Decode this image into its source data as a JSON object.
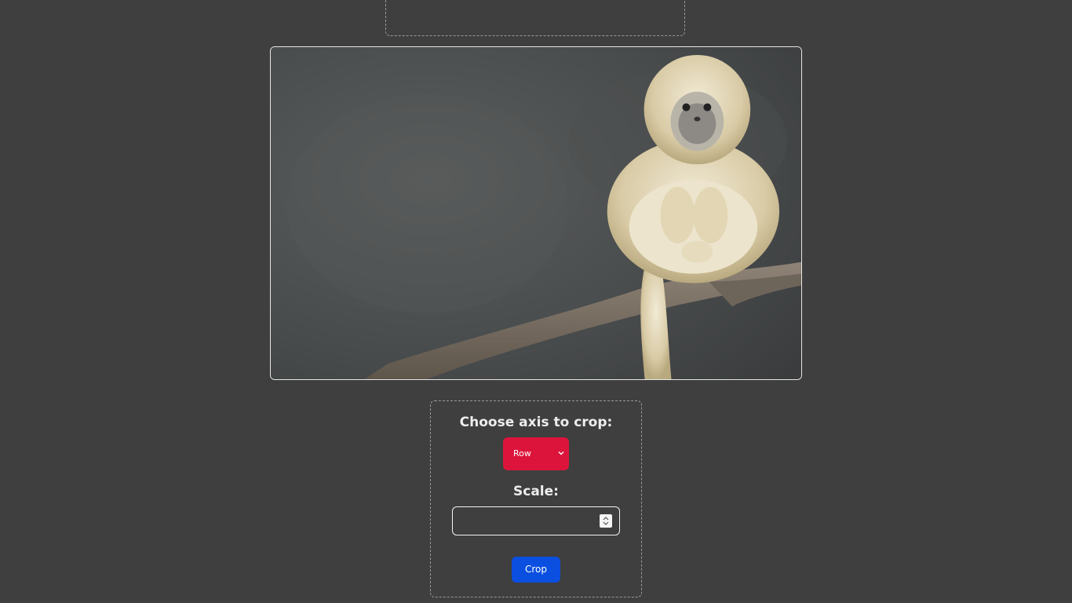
{
  "image": {
    "alt": "monkey-photo"
  },
  "crop_panel": {
    "axis_label": "Choose axis to crop:",
    "axis_select": {
      "selected": "Row"
    },
    "scale_label": "Scale:",
    "scale_input": {
      "value": "",
      "placeholder": ""
    },
    "crop_button": "Crop"
  },
  "colors": {
    "background": "#3f3f3f",
    "select": "#dc143c",
    "button": "#0b4fe0",
    "border": "#e6e6e6"
  }
}
